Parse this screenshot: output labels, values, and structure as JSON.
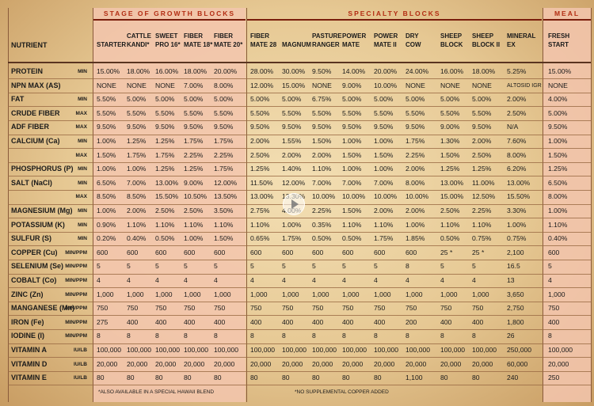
{
  "groups": {
    "growth": "STAGE OF GROWTH BLOCKS",
    "specialty": "SPECIALTY BLOCKS",
    "meal": "MEAL"
  },
  "nutrient_header": "NUTRIENT",
  "products": [
    "STARTER",
    "CATTLE\nKANDI*",
    "SWEET\nPRO 16*",
    "FIBER\nMATE 18*",
    "FIBER\nMATE 20*",
    "FIBER\nMATE 28",
    "MAGNUM",
    "PASTURE\nRANGER",
    "POWER\nMATE",
    "POWER\nMATE II",
    "DRY\nCOW",
    "SHEEP\nBLOCK",
    "SHEEP\nBLOCK II",
    "MINERAL\nEX",
    "FRESH\nSTART"
  ],
  "rows": [
    {
      "nutrient": "PROTEIN",
      "unit": "MIN",
      "values": [
        "15.00%",
        "18.00%",
        "16.00%",
        "18.00%",
        "20.00%",
        "28.00%",
        "30.00%",
        "9.50%",
        "14.00%",
        "20.00%",
        "24.00%",
        "16.00%",
        "18.00%",
        "5.25%",
        "15.00%"
      ]
    },
    {
      "nutrient": "NPN MAX (AS)",
      "unit": "",
      "values": [
        "NONE",
        "NONE",
        "NONE",
        "7.00%",
        "8.00%",
        "12.00%",
        "15.00%",
        "NONE",
        "9.00%",
        "10.00%",
        "NONE",
        "NONE",
        "NONE",
        "ALTOSID IGR",
        "NONE"
      ]
    },
    {
      "nutrient": "FAT",
      "unit": "MIN",
      "values": [
        "5.50%",
        "5.00%",
        "5.00%",
        "5.00%",
        "5.00%",
        "5.00%",
        "5.00%",
        "6.75%",
        "5.00%",
        "5.00%",
        "5.00%",
        "5.00%",
        "5.00%",
        "2.00%",
        "4.00%"
      ]
    },
    {
      "nutrient": "CRUDE FIBER",
      "unit": "MAX",
      "values": [
        "5.50%",
        "5.50%",
        "5.50%",
        "5.50%",
        "5.50%",
        "5.50%",
        "5.50%",
        "5.50%",
        "5.50%",
        "5.50%",
        "5.50%",
        "5.50%",
        "5.50%",
        "2.50%",
        "5.00%"
      ]
    },
    {
      "nutrient": "ADF FIBER",
      "unit": "MAX",
      "values": [
        "9.50%",
        "9.50%",
        "9.50%",
        "9.50%",
        "9.50%",
        "9.50%",
        "9.50%",
        "9.50%",
        "9.50%",
        "9.50%",
        "9.50%",
        "9.00%",
        "9.50%",
        "N/A",
        "9.50%"
      ]
    },
    {
      "nutrient": "CALCIUM (Ca)",
      "unit": "MIN",
      "values": [
        "1.00%",
        "1.25%",
        "1.25%",
        "1.75%",
        "1.75%",
        "2.00%",
        "1.55%",
        "1.50%",
        "1.00%",
        "1.00%",
        "1.75%",
        "1.30%",
        "2.00%",
        "7.60%",
        "1.00%"
      ]
    },
    {
      "nutrient": "",
      "unit": "MAX",
      "values": [
        "1.50%",
        "1.75%",
        "1.75%",
        "2.25%",
        "2.25%",
        "2.50%",
        "2.00%",
        "2.00%",
        "1.50%",
        "1.50%",
        "2.25%",
        "1.50%",
        "2.50%",
        "8.00%",
        "1.50%"
      ]
    },
    {
      "nutrient": "PHOSPHORUS (P)",
      "unit": "MIN",
      "values": [
        "1.00%",
        "1.00%",
        "1.25%",
        "1.25%",
        "1.75%",
        "1.25%",
        "1.40%",
        "1.10%",
        "1.00%",
        "1.00%",
        "2.00%",
        "1.25%",
        "1.25%",
        "6.20%",
        "1.25%"
      ]
    },
    {
      "nutrient": "SALT (NaCl)",
      "unit": "MIN",
      "values": [
        "6.50%",
        "7.00%",
        "13.00%",
        "9.00%",
        "12.00%",
        "11.50%",
        "12.00%",
        "7.00%",
        "7.00%",
        "7.00%",
        "8.00%",
        "13.00%",
        "11.00%",
        "13.00%",
        "6.50%"
      ]
    },
    {
      "nutrient": "",
      "unit": "MAX",
      "values": [
        "8.50%",
        "8.50%",
        "15.50%",
        "10.50%",
        "13.50%",
        "13.00%",
        "13.30%",
        "10.00%",
        "10.00%",
        "10.00%",
        "10.00%",
        "15.00%",
        "12.50%",
        "15.50%",
        "8.00%"
      ]
    },
    {
      "nutrient": "MAGNESIUM (Mg)",
      "unit": "MIN",
      "values": [
        "1.00%",
        "2.00%",
        "2.50%",
        "2.50%",
        "3.50%",
        "2.75%",
        "4.00%",
        "2.25%",
        "1.50%",
        "2.00%",
        "2.00%",
        "2.50%",
        "2.25%",
        "3.30%",
        "1.00%"
      ]
    },
    {
      "nutrient": "POTASSIUM (K)",
      "unit": "MIN",
      "values": [
        "0.90%",
        "1.10%",
        "1.10%",
        "1.10%",
        "1.10%",
        "1.10%",
        "1.00%",
        "0.35%",
        "1.10%",
        "1.10%",
        "1.00%",
        "1.10%",
        "1.10%",
        "1.00%",
        "1.10%"
      ]
    },
    {
      "nutrient": "SULFUR (S)",
      "unit": "MIN",
      "values": [
        "0.20%",
        "0.40%",
        "0.50%",
        "1.00%",
        "1.50%",
        "0.65%",
        "1.75%",
        "0.50%",
        "0.50%",
        "1.75%",
        "1.85%",
        "0.50%",
        "0.75%",
        "0.75%",
        "0.40%"
      ]
    },
    {
      "nutrient": "COPPER (Cu)",
      "unit": "MIN/PPM",
      "values": [
        "600",
        "600",
        "600",
        "600",
        "600",
        "600",
        "600",
        "600",
        "600",
        "600",
        "600",
        "25 *",
        "25 *",
        "2,100",
        "600"
      ]
    },
    {
      "nutrient": "SELENIUM (Se)",
      "unit": "MIN/PPM",
      "values": [
        "5",
        "5",
        "5",
        "5",
        "5",
        "5",
        "5",
        "5",
        "5",
        "5",
        "8",
        "5",
        "5",
        "16.5",
        "5"
      ]
    },
    {
      "nutrient": "COBALT (Co)",
      "unit": "MIN/PPM",
      "values": [
        "4",
        "4",
        "4",
        "4",
        "4",
        "4",
        "4",
        "4",
        "4",
        "4",
        "4",
        "4",
        "4",
        "13",
        "4"
      ]
    },
    {
      "nutrient": "ZINC (Zn)",
      "unit": "MIN/PPM",
      "values": [
        "1,000",
        "1,000",
        "1,000",
        "1,000",
        "1,000",
        "1,000",
        "1,000",
        "1,000",
        "1,000",
        "1,000",
        "1,000",
        "1,000",
        "1,000",
        "3,650",
        "1,000"
      ]
    },
    {
      "nutrient": "MANGANESE (Mn)",
      "unit": "MIN/PPM",
      "values": [
        "750",
        "750",
        "750",
        "750",
        "750",
        "750",
        "750",
        "750",
        "750",
        "750",
        "750",
        "750",
        "750",
        "2,750",
        "750"
      ]
    },
    {
      "nutrient": "IRON (Fe)",
      "unit": "MIN/PPM",
      "values": [
        "275",
        "400",
        "400",
        "400",
        "400",
        "400",
        "400",
        "400",
        "400",
        "400",
        "200",
        "400",
        "400",
        "1,800",
        "400"
      ]
    },
    {
      "nutrient": "IODINE (I)",
      "unit": "MIN/PPM",
      "values": [
        "8",
        "8",
        "8",
        "8",
        "8",
        "8",
        "8",
        "8",
        "8",
        "8",
        "8",
        "8",
        "8",
        "26",
        "8"
      ]
    },
    {
      "nutrient": "VITAMIN A",
      "unit": "IU/LB",
      "values": [
        "100,000",
        "100,000",
        "100,000",
        "100,000",
        "100,000",
        "100,000",
        "100,000",
        "100,000",
        "100,000",
        "100,000",
        "100,000",
        "100,000",
        "100,000",
        "250,000",
        "100,000"
      ]
    },
    {
      "nutrient": "VITAMIN D",
      "unit": "IU/LB",
      "values": [
        "20,000",
        "20,000",
        "20,000",
        "20,000",
        "20,000",
        "20,000",
        "20,000",
        "20,000",
        "20,000",
        "20,000",
        "20,000",
        "20,000",
        "20,000",
        "60,000",
        "20,000"
      ]
    },
    {
      "nutrient": "VITAMIN E",
      "unit": "IU/LB",
      "values": [
        "80",
        "80",
        "80",
        "80",
        "80",
        "80",
        "80",
        "80",
        "80",
        "80",
        "1,100",
        "80",
        "80",
        "240",
        "250"
      ]
    }
  ],
  "footnotes": {
    "hawaii": "*ALSO AVAILABLE IN A SPECIAL HAWAII BLEND",
    "copper": "*NO SUPPLEMENTAL COPPER ADDED"
  },
  "icons": {
    "play": "play-icon"
  },
  "colors": {
    "accent": "#b22c12",
    "band": "#f3c6ae"
  }
}
